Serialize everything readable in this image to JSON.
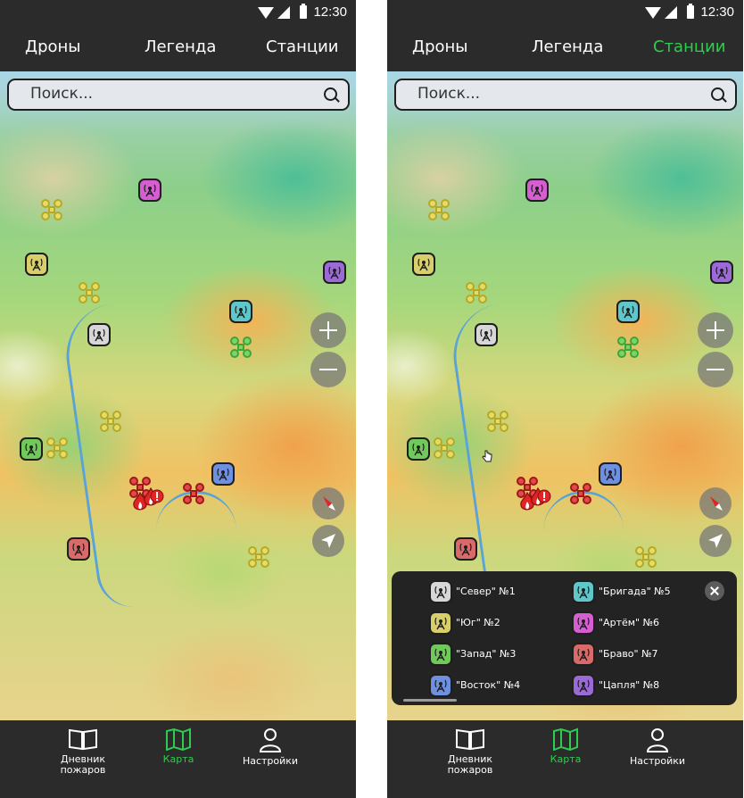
{
  "status": {
    "time": "12:30"
  },
  "tabs": [
    "Дроны",
    "Легенда",
    "Станции"
  ],
  "screens": [
    {
      "active_tab": "Карта",
      "active_top_tab": "none"
    },
    {
      "active_tab": "Карта",
      "active_top_tab": "Станции"
    }
  ],
  "search": {
    "placeholder": "Поиск..."
  },
  "nav": {
    "fire_log": "Дневник пожаров",
    "map": "Карта",
    "settings": "Настройки"
  },
  "legend": {
    "items": [
      {
        "label": "\"Север\" №1",
        "color": "#d7d7d7"
      },
      {
        "label": "\"Бригада\" №5",
        "color": "#5fc6c9"
      },
      {
        "label": "\"Юг\" №2",
        "color": "#d8cf6a"
      },
      {
        "label": "\"Артём\" №6",
        "color": "#d55fd0"
      },
      {
        "label": "\"Запад\" №3",
        "color": "#72c95b"
      },
      {
        "label": "\"Браво\" №7",
        "color": "#d96a6a"
      },
      {
        "label": "\"Восток\" №4",
        "color": "#6f8fe0"
      },
      {
        "label": "\"Цапля\" №8",
        "color": "#9b6ad6"
      }
    ]
  },
  "colors": {
    "accent": "#2ecc4f",
    "bar": "#2b2b2b",
    "fire": "#e02525"
  },
  "icons": [
    "search-icon",
    "plus-icon",
    "minus-icon",
    "compass-icon",
    "locate-icon",
    "book-icon",
    "map-icon",
    "person-icon",
    "close-icon",
    "drone-icon",
    "station-icon",
    "fire-icon"
  ]
}
